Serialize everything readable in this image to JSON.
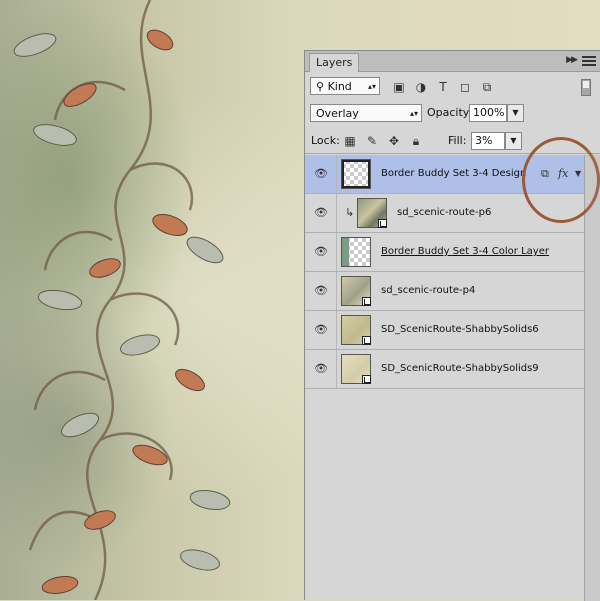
{
  "panel": {
    "tab_label": "Layers",
    "filter": {
      "kind_label": "Kind"
    },
    "blend": {
      "mode": "Overlay",
      "opacity_label": "Opacity:",
      "opacity_value": "100%"
    },
    "lock": {
      "label": "Lock:",
      "fill_label": "Fill:",
      "fill_value": "3%"
    }
  },
  "layers": [
    {
      "name": "Border Buddy Set 3-4  Design",
      "selected": true,
      "visible": true,
      "has_fx": true
    },
    {
      "name": "sd_scenic-route-p6",
      "clipped": true,
      "visible": true
    },
    {
      "name": "Border Buddy Set 3-4 Color Layer ",
      "visible": true
    },
    {
      "name": "sd_scenic-route-p4",
      "visible": true
    },
    {
      "name": "SD_ScenicRoute-ShabbySolids6",
      "visible": true
    },
    {
      "name": "SD_ScenicRoute-ShabbySolids9",
      "visible": true
    }
  ],
  "colors": {
    "selected_row": "#aebfe8",
    "annotation_circle": "#9a5a37",
    "panel_bg": "#d6d6d6"
  }
}
